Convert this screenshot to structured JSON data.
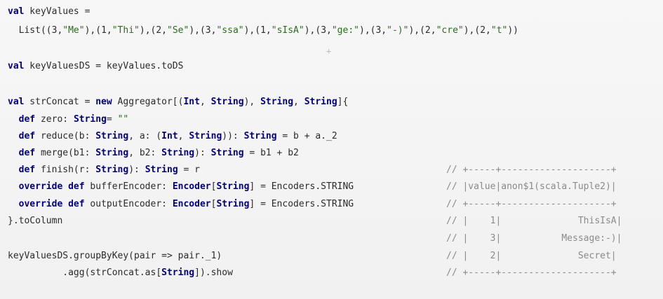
{
  "lines": {
    "l1": "val keyValues =",
    "l2": "  List((3,\"Me\"),(1,\"Thi\"),(2,\"Se\"),(3,\"ssa\"),(1,\"sIsA\"),(3,\"ge:\"),(3,\"-)\"),(2,\"cre\"),(2,\"t\"))",
    "l3": "val keyValuesDS = keyValues.toDS",
    "l4": "val strConcat = new Aggregator[(Int, String), String, String]{",
    "l5": "  def zero: String= \"\"",
    "l6": "  def reduce(b: String, a: (Int, String)): String = b + a._2",
    "l7": "  def merge(b1: String, b2: String): String = b1 + b2",
    "l8": "  def finish(r: String): String = r",
    "l9": "  override def bufferEncoder: Encoder[String] = Encoders.STRING",
    "l10": "  override def outputEncoder: Encoder[String] = Encoders.STRING",
    "l11": "}.toColumn",
    "l12": "keyValuesDS.groupByKey(pair => pair._1)",
    "l13": "          .agg(strConcat.as[String]).show"
  },
  "comments": {
    "c1": "// +-----+--------------------+",
    "c2": "// |value|anon$1(scala.Tuple2)|",
    "c3": "// +-----+--------------------+",
    "c4": "// |    1|              ThisIsA|",
    "c5": "// |    3|           Message:-)|",
    "c6": "// |    2|              Secret|",
    "c7": "// +-----+--------------------+"
  },
  "cursor_glyph": "+"
}
